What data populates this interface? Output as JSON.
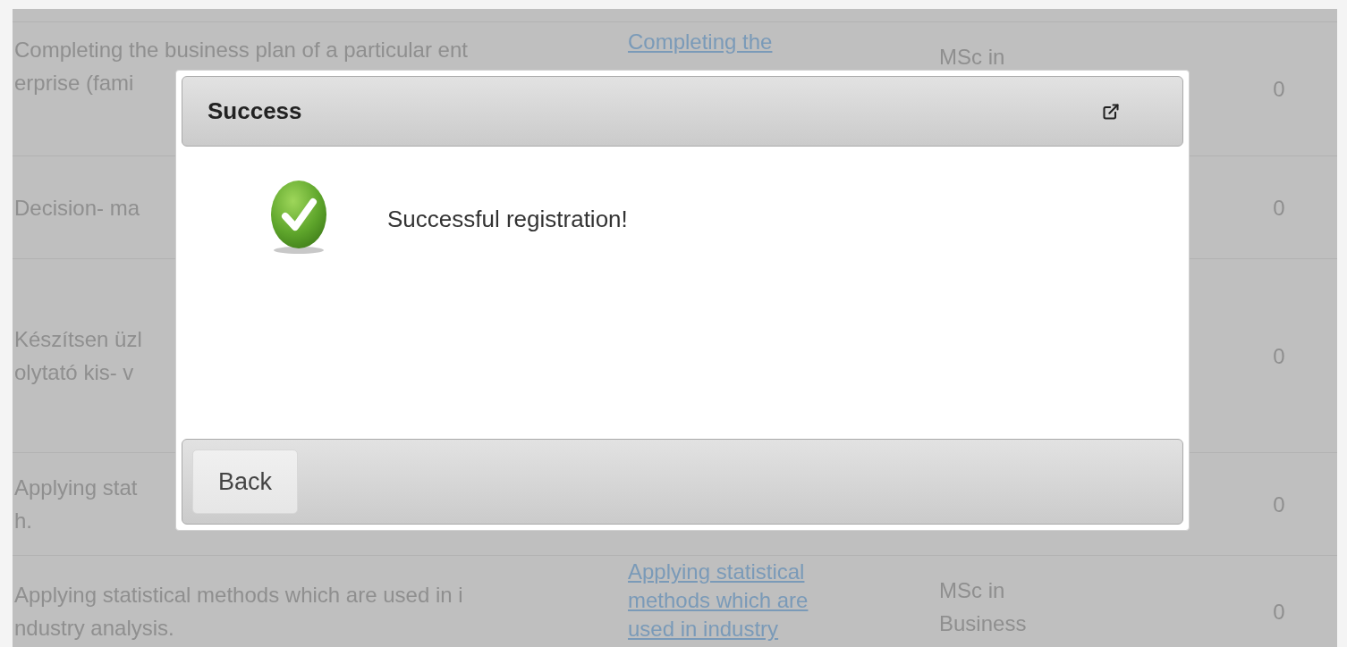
{
  "table": {
    "rows": [
      {
        "column_1": [],
        "column_2": [],
        "column_3": [],
        "column_4": ""
      },
      {
        "column_1": [
          "Completing the business plan of a particular ent",
          "erprise (fami"
        ],
        "column_2": [
          "Completing the"
        ],
        "column_3": [
          "MSc in"
        ],
        "column_4": "0"
      },
      {
        "column_1": [
          "Decision- ma"
        ],
        "column_2": [],
        "column_3": [],
        "column_4": "0"
      },
      {
        "column_1": [
          "Készítsen üzl",
          "olytató kis- v"
        ],
        "column_2": [],
        "column_3": [],
        "column_4": "0"
      },
      {
        "column_1": [
          "Applying stat",
          "h."
        ],
        "column_2": [],
        "column_3": [],
        "column_4": "0"
      },
      {
        "column_1": [
          "Applying statistical methods which are used in i",
          "ndustry analysis."
        ],
        "column_2": [
          "Applying statistical",
          "methods which are",
          "used in industry"
        ],
        "column_3": [
          "MSc in",
          "Business"
        ],
        "column_4": "0"
      }
    ]
  },
  "dialog": {
    "title": "Success",
    "message": "Successful registration!",
    "buttons": [
      "Back"
    ]
  }
}
